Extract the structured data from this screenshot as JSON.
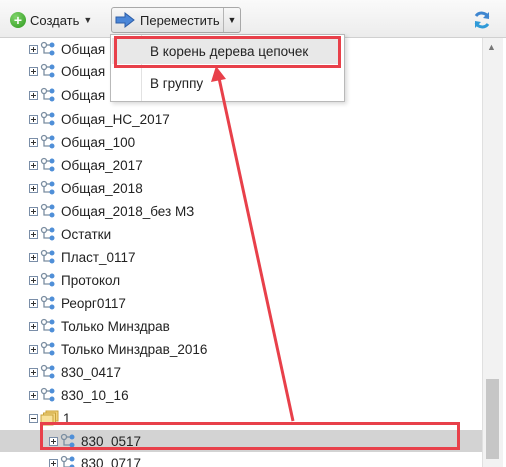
{
  "toolbar": {
    "create_label": "Создать",
    "move_label": "Переместить"
  },
  "move_menu": {
    "items": [
      {
        "label": "В корень дерева цепочек"
      },
      {
        "label": "В группу"
      }
    ]
  },
  "tree": {
    "items": [
      {
        "label": "Общая"
      },
      {
        "label": "Общая"
      },
      {
        "label": "Общая"
      },
      {
        "label": "Общая_НС_2017"
      },
      {
        "label": "Общая_100"
      },
      {
        "label": "Общая_2017"
      },
      {
        "label": "Общая_2018"
      },
      {
        "label": "Общая_2018_без МЗ"
      },
      {
        "label": "Остатки"
      },
      {
        "label": "Пласт_0117"
      },
      {
        "label": "Протокол"
      },
      {
        "label": "Реорг0117"
      },
      {
        "label": "Только Минздрав"
      },
      {
        "label": "Только Минздрав_2016"
      },
      {
        "label": "830_0417"
      },
      {
        "label": "830_10_16"
      },
      {
        "label": "1"
      },
      {
        "label": "830_0517"
      },
      {
        "label": "830_0717"
      }
    ]
  },
  "colors": {
    "annotation": "#e8404a",
    "selection": "#d3d3d3",
    "accent_blue": "#3b78c8"
  }
}
